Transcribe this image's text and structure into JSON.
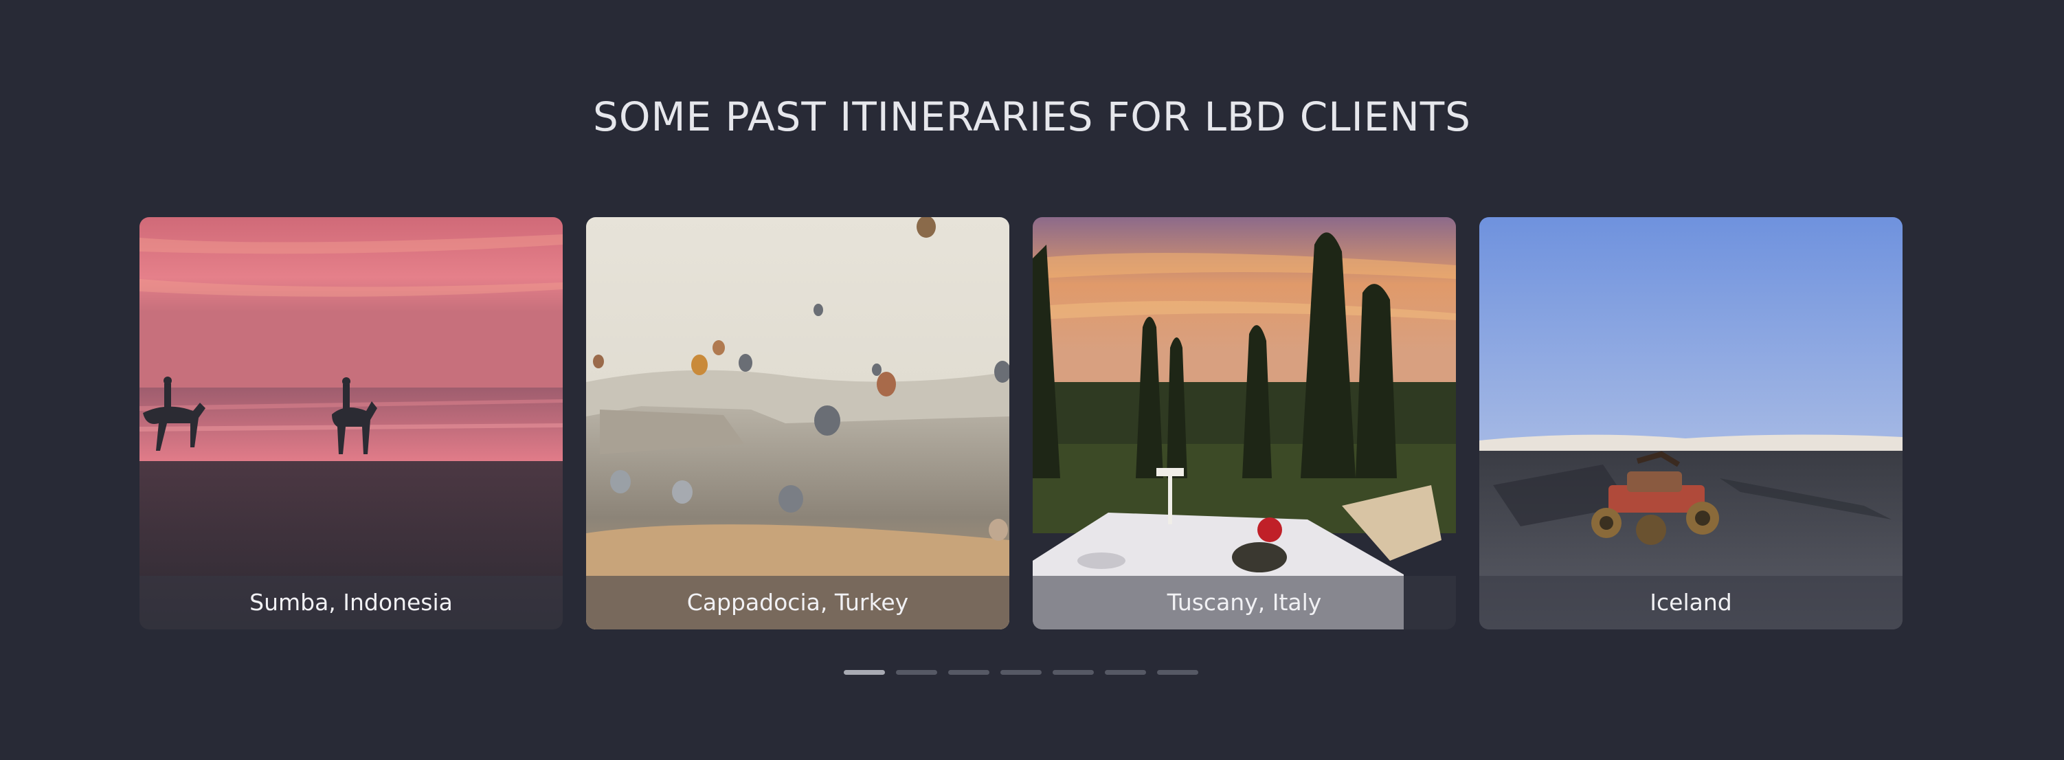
{
  "section": {
    "title": "SOME PAST ITINERARIES FOR LBD CLIENTS"
  },
  "cards": [
    {
      "caption": "Sumba, Indonesia",
      "image": "sunset-beach-horse-riders-image"
    },
    {
      "caption": "Cappadocia, Turkey",
      "image": "hot-air-balloons-valley-image"
    },
    {
      "caption": "Tuscany, Italy",
      "image": "cypress-trees-dinner-table-image"
    },
    {
      "caption": "Iceland",
      "image": "quad-bike-black-sand-image"
    }
  ],
  "pagination": {
    "count": 7,
    "active_index": 0
  },
  "colors": {
    "background": "#282a36",
    "title": "#e6e7ec",
    "dot_active": "#a8aab3",
    "dot_inactive": "#565965"
  }
}
